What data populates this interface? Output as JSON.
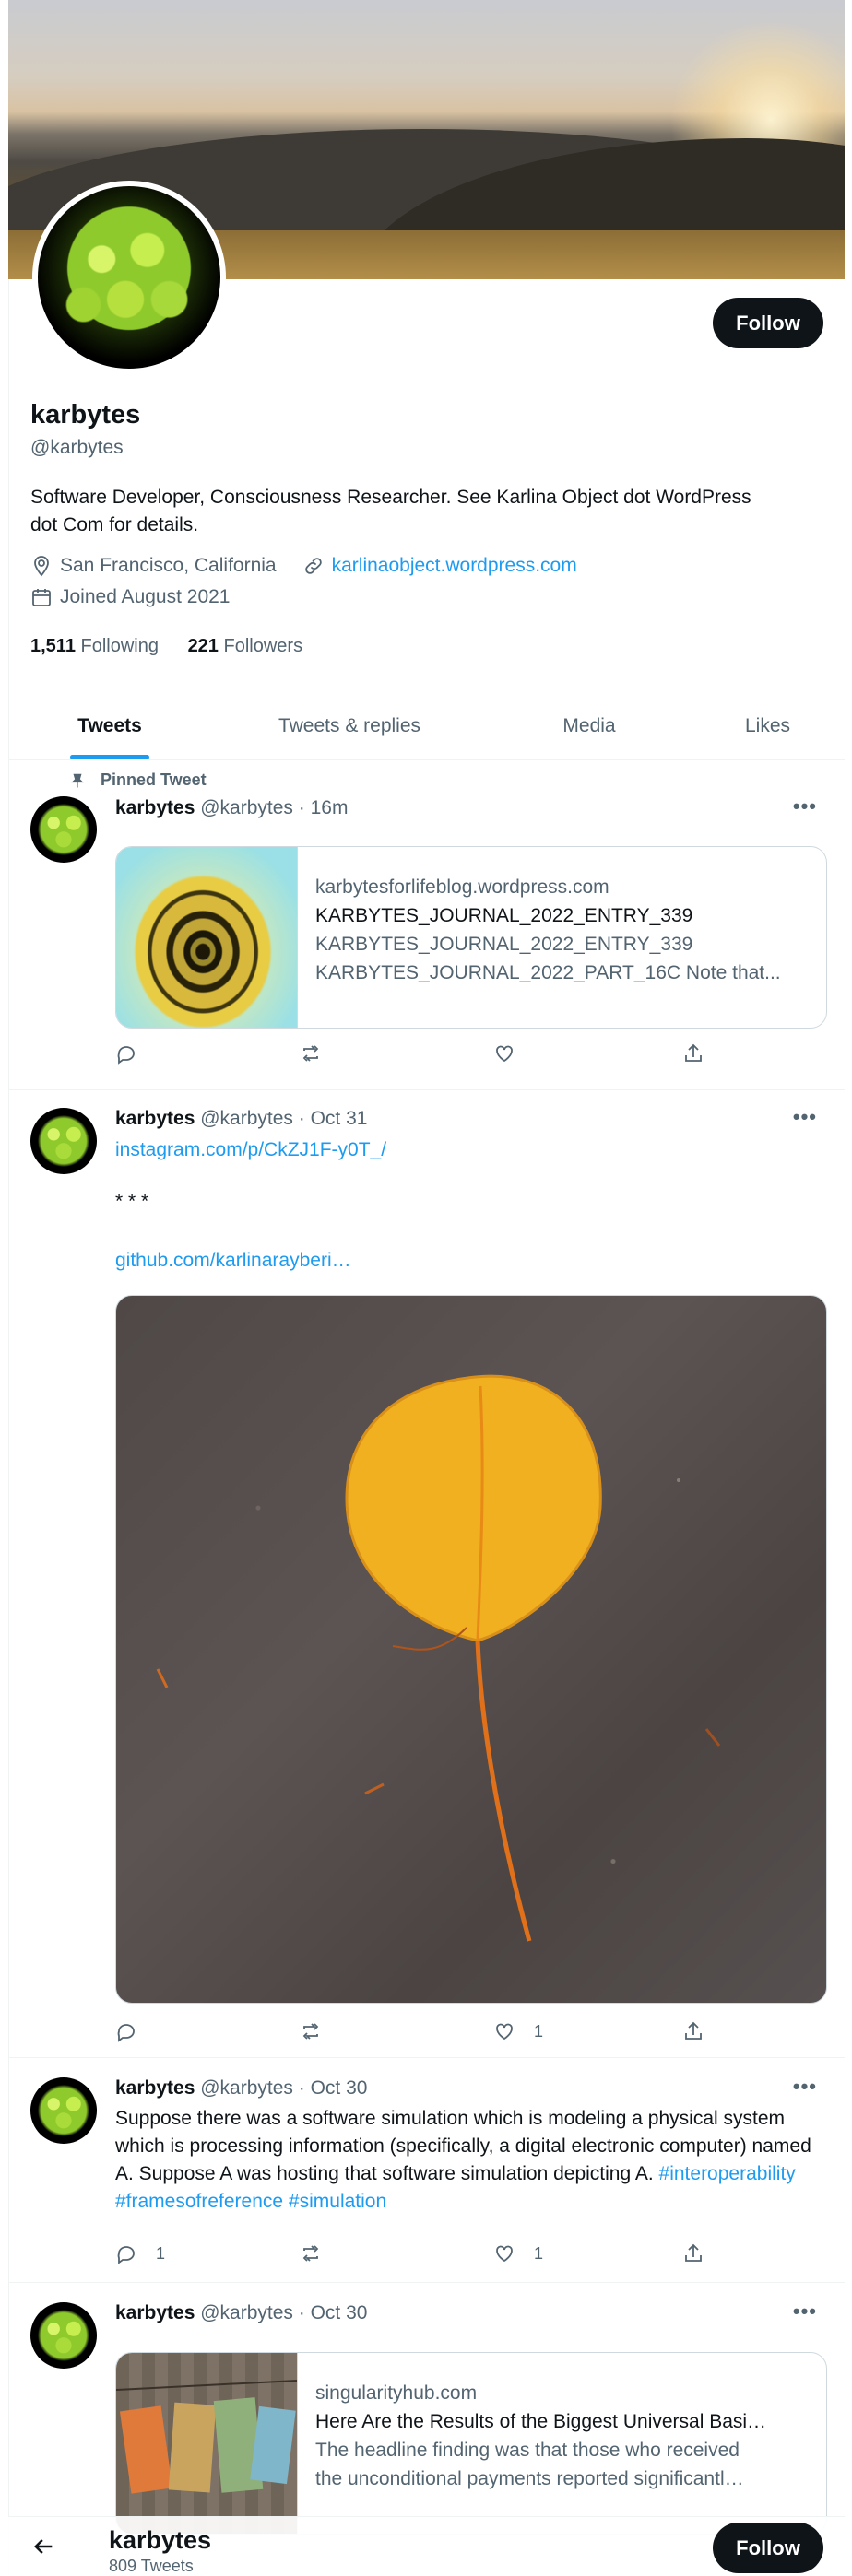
{
  "profile": {
    "name": "karbytes",
    "handle": "@karbytes",
    "bio": "Software Developer, Consciousness Researcher. See Karlina Object dot WordPress dot Com for details.",
    "location": "San Francisco, California",
    "website": "karlinaobject.wordpress.com",
    "joined": "Joined August 2021",
    "following_count": "1,511",
    "following_label": "Following",
    "followers_count": "221",
    "followers_label": "Followers",
    "follow_label": "Follow"
  },
  "tabs": [
    {
      "label": "Tweets",
      "active": true
    },
    {
      "label": "Tweets & replies"
    },
    {
      "label": "Media"
    },
    {
      "label": "Likes"
    }
  ],
  "pinned_label": "Pinned Tweet",
  "tweets": [
    {
      "name": "karbytes",
      "handle": "@karbytes",
      "time": "· 16m",
      "card": {
        "domain": "karbytesforlifeblog.wordpress.com",
        "title": "KARBYTES_JOURNAL_2022_ENTRY_339",
        "desc1": "KARBYTES_JOURNAL_2022_ENTRY_339",
        "desc2": "KARBYTES_JOURNAL_2022_PART_16C Note that..."
      },
      "likes": ""
    },
    {
      "name": "karbytes",
      "handle": "@karbytes",
      "time": "· Oct 31",
      "link1": "instagram.com/p/CkZJ1F-y0T_/",
      "separator": "* * *",
      "link2": "github.com/karlinarayberi…",
      "likes": "1"
    },
    {
      "name": "karbytes",
      "handle": "@karbytes",
      "time": "· Oct 30",
      "text": "Suppose there was a software simulation which is modeling a physical system which is processing information (specifically, a digital electronic computer) named A. Suppose A was hosting that software simulation depicting A.",
      "hashtags": "#interoperability #framesofreference #simulation",
      "replies": "1",
      "likes": "1"
    },
    {
      "name": "karbytes",
      "handle": "@karbytes",
      "time": "· Oct 30",
      "card": {
        "domain": "singularityhub.com",
        "title": "Here Are the Results of the Biggest Universal Basi…",
        "desc1": "The headline finding was that those who received",
        "desc2": "the unconditional payments reported significantl…"
      }
    }
  ],
  "bottom_bar": {
    "name": "karbytes",
    "tweet_count": "809 Tweets",
    "follow_label": "Follow"
  }
}
